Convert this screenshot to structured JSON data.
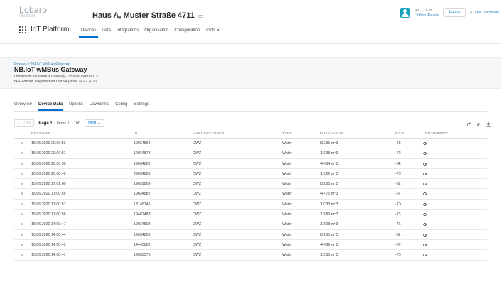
{
  "header": {
    "logo_text": "Lobaro",
    "logo_sub": "Platform",
    "property": "Haus A, Muster Straße 4711",
    "platform_name": "IoT Platform",
    "nav": [
      "Devices",
      "Data",
      "Integrations",
      "Organisation",
      "Configuration",
      "Tools ∨"
    ],
    "account_label": "ACCOUNT",
    "account_name": "Tobias Rende",
    "logout": "Logout",
    "legal": "• Legal Disclosure"
  },
  "device": {
    "breadcrumb": "Devices > NB.IoT wMBus Gateway",
    "title": "NB.IoT wMBus Gateway",
    "line1": "Lobaro NB-IoT wMBus Gateway · 352656100910013",
    "line2": "nRF wMBus Liegenschaft Test 94 (since 14.02.2020)"
  },
  "tabs": [
    "Overview",
    "Device Data",
    "Uplinks",
    "Downlinks",
    "Config",
    "Settings"
  ],
  "pager": {
    "prev": "← Prev",
    "page": "Page 1",
    "items": "Items 1 .. 100",
    "next": "Next →"
  },
  "table": {
    "headers": [
      "RECEIVED",
      "ID",
      "MANUFACTURER",
      "TYPE",
      "MAIN VALUE",
      "RSSI",
      "ENCRYPTED"
    ],
    "rows": [
      [
        "15.06.2020 20:00:52",
        "19034869",
        "DWZ",
        "Water",
        "8.235 m^3",
        "-63"
      ],
      [
        "15.06.2020 20:00:51",
        "19034878",
        "DWZ",
        "Water",
        "1.038 m^3",
        "-72"
      ],
      [
        "15.06.2020 20:00:50",
        "19034882",
        "DWZ",
        "Water",
        "4.484 m^3",
        "-64"
      ],
      [
        "15.06.2020 20:00:49",
        "29034883",
        "DWZ",
        "Water",
        "1.922 m^3",
        "-78"
      ],
      [
        "15.06.2020 17:01:00",
        "19031869",
        "DWZ",
        "Water",
        "8.238 m^3",
        "-61"
      ],
      [
        "15.06.2020 17:00:59",
        "19034882",
        "DWZ",
        "Water",
        "4.475 m^3",
        "-67"
      ],
      [
        "15.06.2020 17:00:57",
        "13145746",
        "DWZ",
        "Water",
        "1.033 m^3",
        "-70"
      ],
      [
        "15.06.2020 17:00:56",
        "19481483",
        "DWZ",
        "Water",
        "1.989 m^3",
        "-76"
      ],
      [
        "15.06.2020 14:00:47",
        "19034508",
        "DWZ",
        "Water",
        "1.908 m^3",
        "-76"
      ],
      [
        "15.06.2020 14:00:44",
        "19034869",
        "DWZ",
        "Water",
        "8.235 m^3",
        "-61"
      ],
      [
        "15.06.2020 14:00:43",
        "14445882",
        "DWZ",
        "Water",
        "4.489 m^3",
        "-67"
      ],
      [
        "15.06.2020 14:00:41",
        "19053576",
        "DWZ",
        "Water",
        "1.033 m^3",
        "-70"
      ]
    ]
  }
}
